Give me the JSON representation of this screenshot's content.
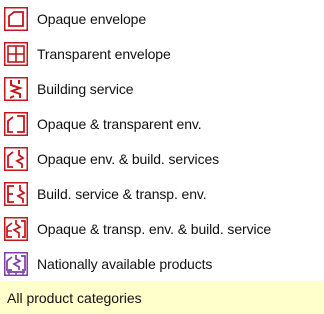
{
  "colors": {
    "accent": "#c4161c",
    "purple": "#7b3fa8",
    "highlight": "#ffffcc"
  },
  "items": [
    {
      "label": "Opaque envelope",
      "icon": "opaque-envelope-icon"
    },
    {
      "label": "Transparent envelope",
      "icon": "transparent-envelope-icon"
    },
    {
      "label": "Building service",
      "icon": "building-service-icon"
    },
    {
      "label": "Opaque & transparent env.",
      "icon": "opaque-transparent-env-icon"
    },
    {
      "label": "Opaque env. & build. services",
      "icon": "opaque-env-build-services-icon"
    },
    {
      "label": "Build. service & transp. env.",
      "icon": "build-service-transp-env-icon"
    },
    {
      "label": "Opaque & transp. env. & build. service",
      "icon": "opaque-transp-env-build-service-icon"
    },
    {
      "label": "Nationally available products",
      "icon": "nationally-available-products-icon"
    }
  ],
  "all_categories": {
    "label": "All product categories"
  }
}
